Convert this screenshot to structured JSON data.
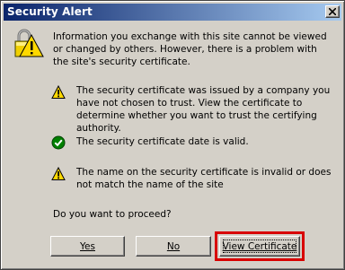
{
  "window": {
    "title": "Security Alert"
  },
  "intro_text": "Information you exchange with this site cannot be viewed or changed by others. However, there is a problem with the site's security certificate.",
  "checks": [
    {
      "status": "warning",
      "icon": "warning-icon",
      "text": "The security certificate was issued by a company you have not chosen to trust. View the certificate to determine whether you want to trust the certifying authority."
    },
    {
      "status": "ok",
      "icon": "check-icon",
      "text": "The security certificate date is valid."
    },
    {
      "status": "warning",
      "icon": "warning-icon",
      "text": "The name on the security certificate is invalid or does not match the name of the site"
    }
  ],
  "question": "Do you want to proceed?",
  "buttons": {
    "yes": "Yes",
    "no": "No",
    "view_certificate": "View Certificate"
  },
  "colors": {
    "titlebar_start": "#0a246a",
    "titlebar_end": "#a6caf0",
    "dialog_bg": "#d4d0c8",
    "warning": "#ffd800",
    "ok": "#008000",
    "highlight": "#d80000"
  }
}
